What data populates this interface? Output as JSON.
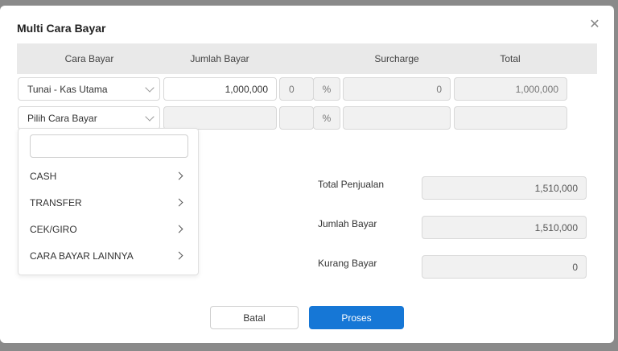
{
  "dialog": {
    "title": "Multi Cara Bayar"
  },
  "table": {
    "headers": [
      "Cara Bayar",
      "Jumlah Bayar",
      "Surcharge",
      "Total"
    ],
    "rows": [
      {
        "method": "Tunai - Kas Utama",
        "amount": "1,000,000",
        "surcharge_pct": "0",
        "pct_symbol": "%",
        "surcharge": "0",
        "total": "1,000,000"
      },
      {
        "method": "Pilih Cara Bayar",
        "amount": "",
        "surcharge_pct": "",
        "pct_symbol": "%",
        "surcharge": "",
        "total": ""
      }
    ]
  },
  "dropdown": {
    "search_value": "",
    "items": [
      "CASH",
      "TRANSFER",
      "CEK/GIRO",
      "CARA BAYAR LAINNYA"
    ]
  },
  "summary": {
    "total_penjualan_label": "Total Penjualan",
    "total_penjualan_value": "1,510,000",
    "jumlah_bayar_label": "Jumlah Bayar",
    "jumlah_bayar_value": "1,510,000",
    "kurang_bayar_label": "Kurang Bayar",
    "kurang_bayar_value": "0"
  },
  "buttons": {
    "cancel": "Batal",
    "submit": "Proses"
  },
  "colors": {
    "primary": "#1677d6",
    "header_bg": "#e9e9e9",
    "overlay": "#8a8a8a"
  }
}
